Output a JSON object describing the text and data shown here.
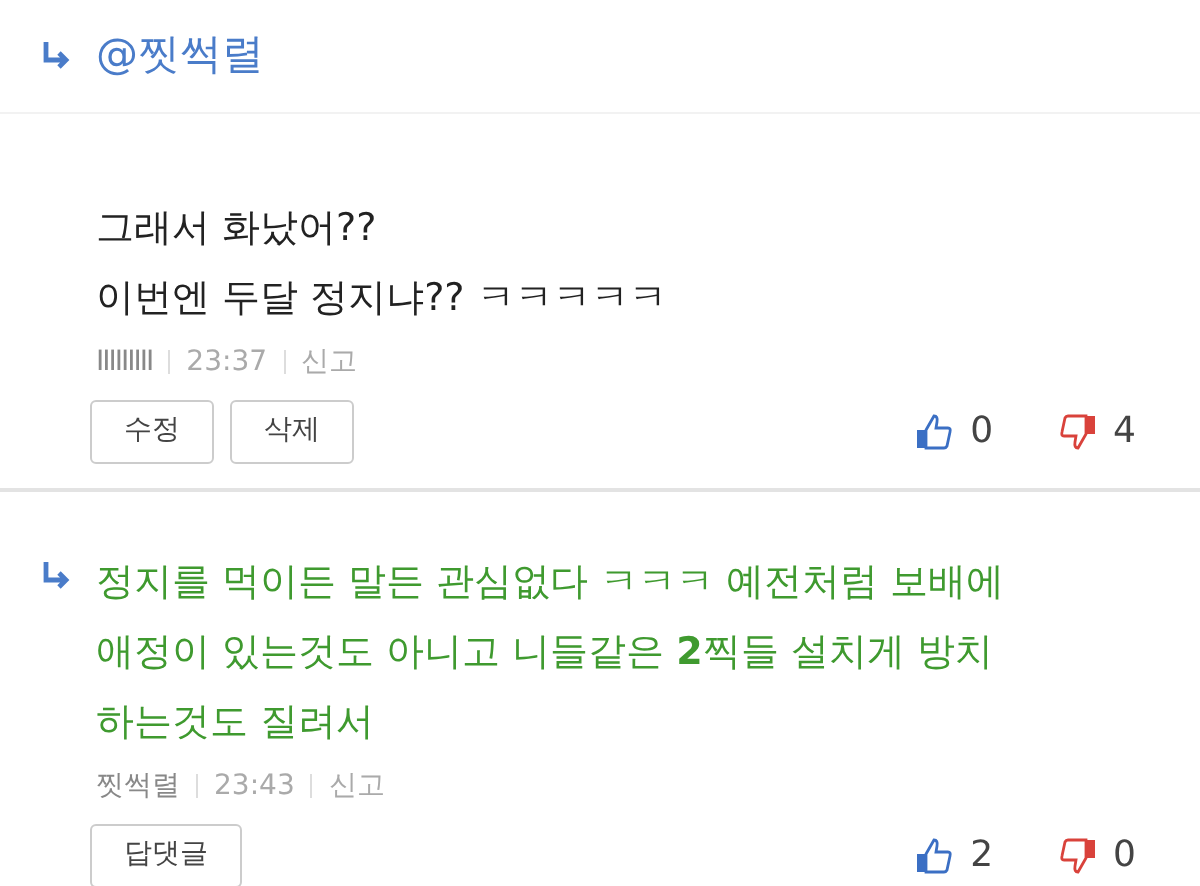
{
  "reply_to": {
    "mention": "@찟썩렬"
  },
  "comments": [
    {
      "kind": "plain",
      "lines": [
        "그래서 화났어??",
        "이번엔 두달 정지냐?? ㅋㅋㅋㅋㅋ"
      ],
      "author": "IIIIIIIII",
      "time": "23:37",
      "report": "신고",
      "buttons": [
        "수정",
        "삭제"
      ],
      "likes": "0",
      "dislikes": "4"
    },
    {
      "kind": "reply",
      "lines": [
        "정지를 먹이든 말든 관심없다 ㅋㅋㅋ 예전처럼 보배에",
        "애정이 있는것도 아니고 니들같은 **2**찍들 설치게 방치",
        "하는것도 질려서"
      ],
      "author": "찟썩렬",
      "time": "23:43",
      "report": "신고",
      "buttons": [
        "답댓글"
      ],
      "likes": "2",
      "dislikes": "0"
    }
  ]
}
